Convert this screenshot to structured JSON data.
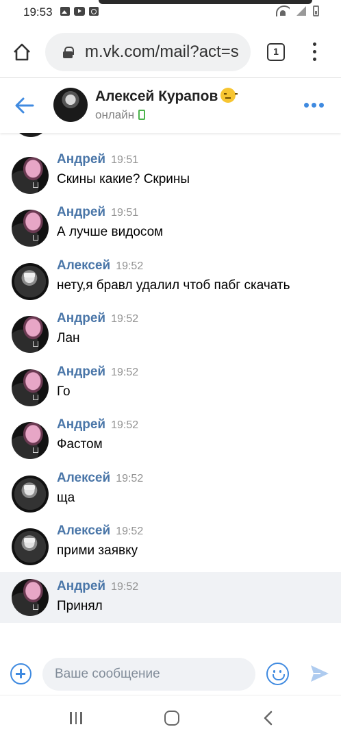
{
  "status_bar": {
    "time": "19:53"
  },
  "browser": {
    "url": "m.vk.com/mail?act=s",
    "tab_count": "1",
    "icons": [
      "home-icon",
      "lock-icon",
      "tabs-icon",
      "menu-icon"
    ]
  },
  "chat": {
    "contact_name": "Алексей Курапов",
    "contact_status": "онлайн",
    "icons": [
      "back-arrow-icon",
      "emoji-expressionless-icon",
      "mobile-icon",
      "more-icon"
    ]
  },
  "messages": [
    {
      "sender": "Андрей",
      "time": "19:51",
      "text": "Скины какие? Скрины",
      "avatar": "andrey"
    },
    {
      "sender": "Андрей",
      "time": "19:51",
      "text": "А лучше видосом",
      "avatar": "andrey"
    },
    {
      "sender": "Алексей",
      "time": "19:52",
      "text": "нету,я бравл удалил чтоб пабг скачать",
      "avatar": "aleksey"
    },
    {
      "sender": "Андрей",
      "time": "19:52",
      "text": "Лан",
      "avatar": "andrey"
    },
    {
      "sender": "Андрей",
      "time": "19:52",
      "text": "Го",
      "avatar": "andrey"
    },
    {
      "sender": "Андрей",
      "time": "19:52",
      "text": "Фастом",
      "avatar": "andrey"
    },
    {
      "sender": "Алексей",
      "time": "19:52",
      "text": "ща",
      "avatar": "aleksey"
    },
    {
      "sender": "Алексей",
      "time": "19:52",
      "text": "прими заявку",
      "avatar": "aleksey"
    },
    {
      "sender": "Андрей",
      "time": "19:52",
      "text": "Принял",
      "avatar": "andrey",
      "highlighted": true
    }
  ],
  "composer": {
    "placeholder": "Ваше сообщение",
    "icons": [
      "attach-plus-icon",
      "emoji-icon",
      "send-icon"
    ]
  },
  "colors": {
    "accent": "#3f8ae0",
    "sender_name": "#4a76a8",
    "online": "#4bb34b",
    "highlight_row": "#f0f2f5"
  }
}
